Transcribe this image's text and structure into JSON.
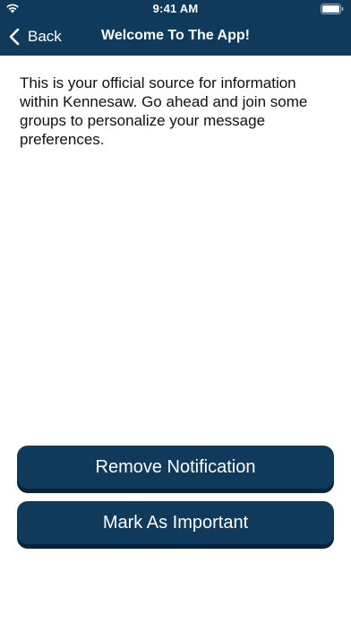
{
  "status_bar": {
    "time": "9:41 AM",
    "icons": [
      "wifi-icon",
      "battery-icon"
    ]
  },
  "nav": {
    "back_label": "Back",
    "back_icon": "chevron-left-icon",
    "title": "Welcome To The App!"
  },
  "message": {
    "body": "This is your official source for information within Kennesaw. Go ahead and join some groups to personalize your message preferences."
  },
  "actions": {
    "remove_label": "Remove Notification",
    "important_label": "Mark As Important"
  },
  "colors": {
    "brand": "#0f3a5c",
    "button_shadow": "#06243e",
    "text": "#111111",
    "background": "#ffffff"
  }
}
